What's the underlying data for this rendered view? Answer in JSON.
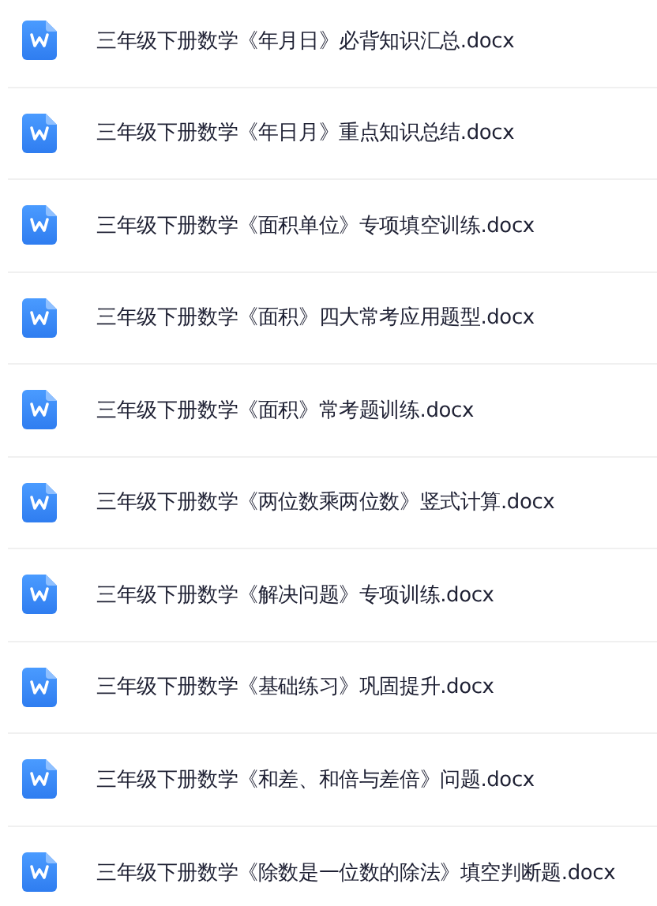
{
  "files": [
    {
      "name": "三年级下册数学《年月日》必背知识汇总.docx"
    },
    {
      "name": "三年级下册数学《年日月》重点知识总结.docx"
    },
    {
      "name": "三年级下册数学《面积单位》专项填空训练.docx"
    },
    {
      "name": "三年级下册数学《面积》四大常考应用题型.docx"
    },
    {
      "name": "三年级下册数学《面积》常考题训练.docx"
    },
    {
      "name": "三年级下册数学《两位数乘两位数》竖式计算.docx"
    },
    {
      "name": "三年级下册数学《解决问题》专项训练.docx"
    },
    {
      "name": "三年级下册数学《基础练习》巩固提升.docx"
    },
    {
      "name": "三年级下册数学《和差、和倍与差倍》问题.docx"
    },
    {
      "name": "三年级下册数学《除数是一位数的除法》填空判断题.docx"
    }
  ]
}
